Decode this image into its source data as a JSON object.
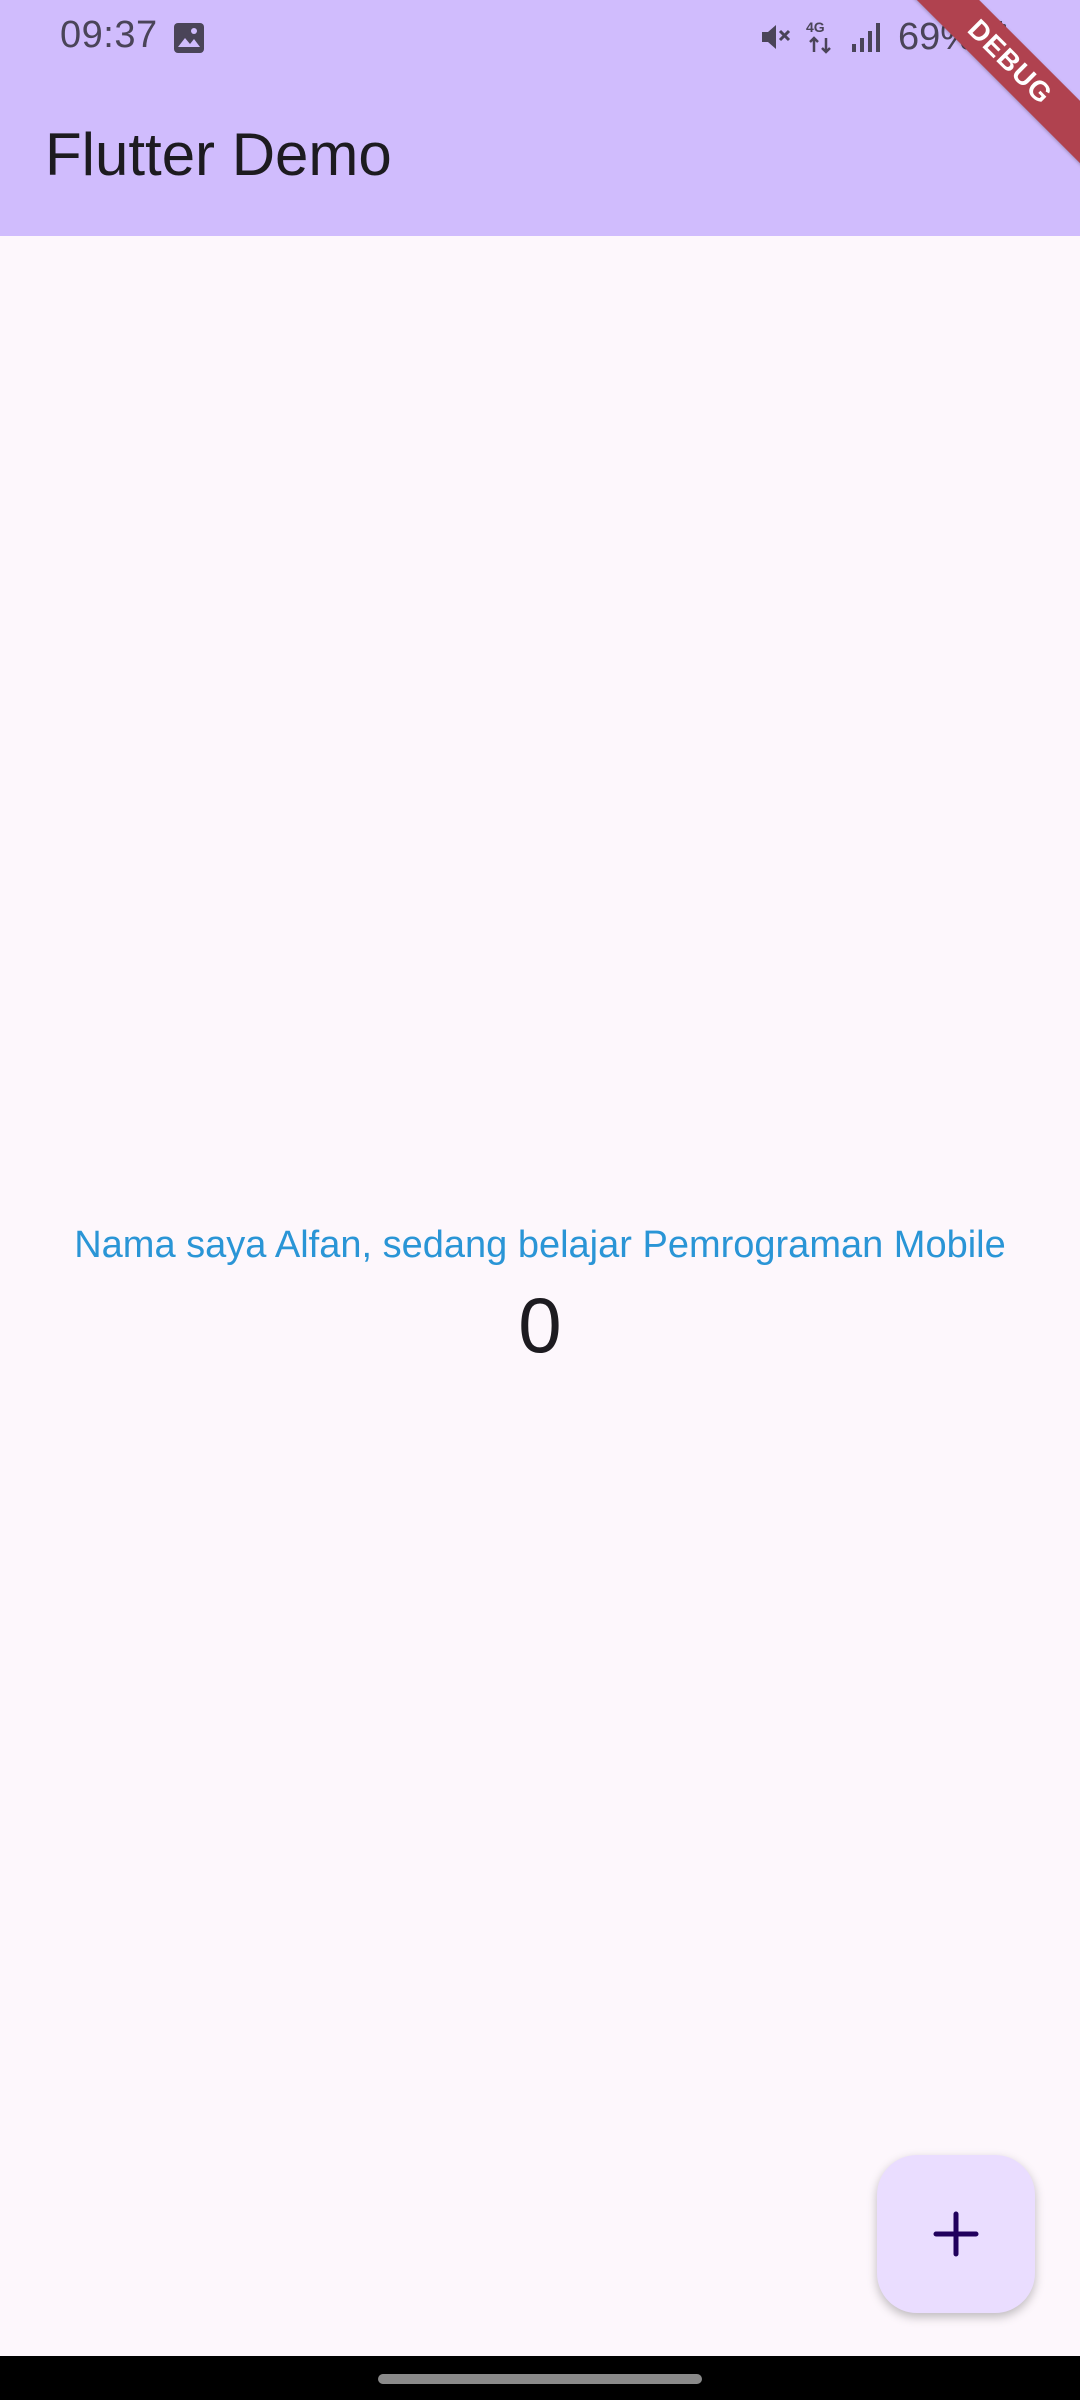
{
  "status_bar": {
    "time": "09:37",
    "battery": "69%",
    "network": "4G",
    "icons": [
      "gallery-icon",
      "mute-icon",
      "4g-icon",
      "signal-icon",
      "battery-icon"
    ]
  },
  "app_bar": {
    "title": "Flutter Demo",
    "color": "#d0bcfd"
  },
  "debug_banner": {
    "label": "DEBUG",
    "color": "#b0424f"
  },
  "body": {
    "message": "Nama saya Alfan, sedang belajar Pemrograman Mobile",
    "message_color": "#2a95d6",
    "counter": "0"
  },
  "fab": {
    "icon": "plus-icon",
    "color": "#eaddff"
  }
}
